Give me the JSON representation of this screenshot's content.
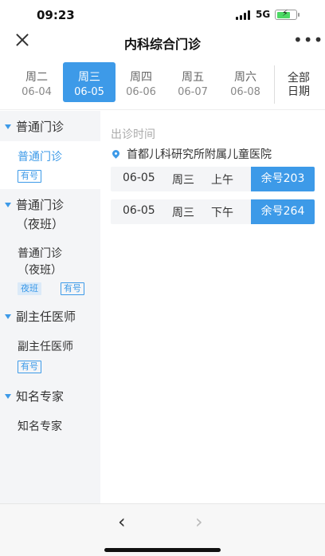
{
  "status_bar": {
    "time": "09:23",
    "network": "5G"
  },
  "nav": {
    "title": "内科综合门诊"
  },
  "dates": [
    {
      "weekday": "周二",
      "date": "06-04",
      "active": false
    },
    {
      "weekday": "周三",
      "date": "06-05",
      "active": true
    },
    {
      "weekday": "周四",
      "date": "06-06",
      "active": false
    },
    {
      "weekday": "周五",
      "date": "06-07",
      "active": false
    },
    {
      "weekday": "周六",
      "date": "06-08",
      "active": false
    }
  ],
  "all_dates": {
    "line1": "全部",
    "line2": "日期"
  },
  "sidebar": {
    "sections": [
      {
        "header": "普通门诊",
        "item": {
          "label": "普通门诊",
          "tag": "有号"
        }
      },
      {
        "header_line1": "普通门诊",
        "header_line2": "（夜班）",
        "item": {
          "label_line1": "普通门诊",
          "label_line2": "（夜班）",
          "tag1": "夜班",
          "tag2": "有号"
        }
      },
      {
        "header": "副主任医师",
        "item": {
          "label": "副主任医师",
          "tag": "有号"
        }
      },
      {
        "header": "知名专家",
        "item": {
          "label": "知名专家"
        }
      }
    ]
  },
  "content": {
    "section_label": "出诊时间",
    "hospital": "首都儿科研究所附属儿童医院",
    "slots": [
      {
        "date": "06-05",
        "weekday": "周三",
        "period": "上午",
        "remain": "余号203"
      },
      {
        "date": "06-05",
        "weekday": "周三",
        "period": "下午",
        "remain": "余号264"
      }
    ]
  },
  "bottom": {
    "back": "‹",
    "forward": "›"
  },
  "colors": {
    "accent": "#3d9ae8",
    "sidebar_bg": "#f4f5f7"
  }
}
